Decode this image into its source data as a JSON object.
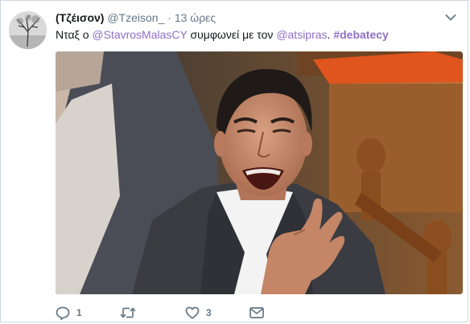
{
  "tweet": {
    "display_name": "(Τζέισον)",
    "handle": "@Tzeison_",
    "separator": "·",
    "time": "13 ώρες",
    "text_prefix": "Νταξ ο ",
    "mention_1": "@StavrosMalasCY",
    "text_middle": " συμφωνεί με τον ",
    "mention_2": "@atsipras",
    "text_period": ". ",
    "hashtag": "#debatecy"
  },
  "icons": {
    "menu": "chevron-down-icon",
    "reply": "reply-icon",
    "retweet": "retweet-icon",
    "like": "heart-icon",
    "message": "envelope-icon"
  },
  "actions": {
    "reply_count": "1",
    "retweet_count": "",
    "like_count": "3"
  },
  "colors": {
    "link": "#8e6fc7",
    "muted": "#657786",
    "text": "#14171a"
  }
}
